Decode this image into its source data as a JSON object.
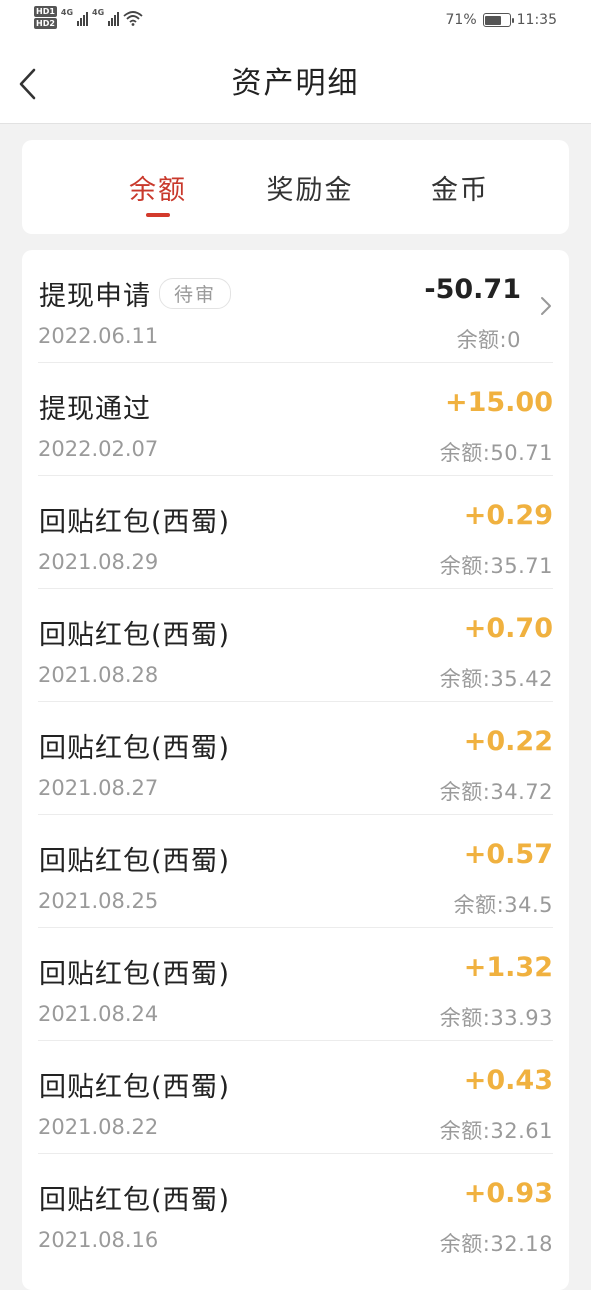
{
  "status_bar": {
    "hd1": "HD1",
    "hd2": "HD2",
    "net1": "4G",
    "net2": "4G",
    "battery_text": "71%",
    "battery_level": 0.71,
    "time": "11:35"
  },
  "header": {
    "title": "资产明细",
    "back_icon": "chevron-left-icon"
  },
  "tabs": [
    {
      "label": "余额",
      "active": true
    },
    {
      "label": "奖励金",
      "active": false
    },
    {
      "label": "金币",
      "active": false
    }
  ],
  "colors": {
    "accent_red": "#c9392c",
    "positive_amount": "#f0b13f"
  },
  "transactions": [
    {
      "title": "提现申请",
      "badge": "待审",
      "date": "2022.06.11",
      "amount": "-50.71",
      "balance": "余额:0"
    },
    {
      "title": "提现通过",
      "date": "2022.02.07",
      "amount": "+15.00",
      "balance": "余额:50.71"
    },
    {
      "title": "回贴红包(西蜀)",
      "date": "2021.08.29",
      "amount": "+0.29",
      "balance": "余额:35.71"
    },
    {
      "title": "回贴红包(西蜀)",
      "date": "2021.08.28",
      "amount": "+0.70",
      "balance": "余额:35.42"
    },
    {
      "title": "回贴红包(西蜀)",
      "date": "2021.08.27",
      "amount": "+0.22",
      "balance": "余额:34.72"
    },
    {
      "title": "回贴红包(西蜀)",
      "date": "2021.08.25",
      "amount": "+0.57",
      "balance": "余额:34.5"
    },
    {
      "title": "回贴红包(西蜀)",
      "date": "2021.08.24",
      "amount": "+1.32",
      "balance": "余额:33.93"
    },
    {
      "title": "回贴红包(西蜀)",
      "date": "2021.08.22",
      "amount": "+0.43",
      "balance": "余额:32.61"
    },
    {
      "title": "回贴红包(西蜀)",
      "date": "2021.08.16",
      "amount": "+0.93",
      "balance": "余额:32.18"
    }
  ]
}
